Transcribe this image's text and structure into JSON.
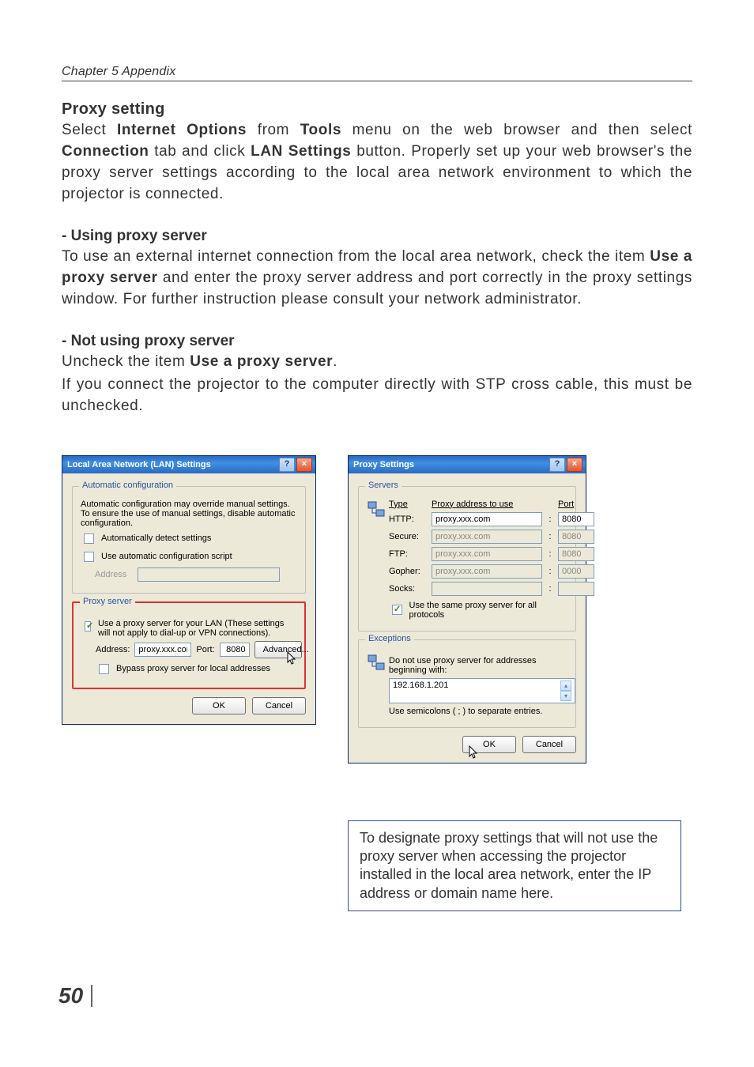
{
  "header": {
    "chapter": "Chapter 5 Appendix"
  },
  "section": {
    "title": "Proxy setting",
    "intro_parts": {
      "t1": "Select ",
      "b1": "Internet Options",
      "t2": " from ",
      "b2": "Tools",
      "t3": " menu on the web browser and then select ",
      "b3": "Connection",
      "t4": " tab and click ",
      "b4": "LAN Settings",
      "t5": " button. Properly set up your web browser's the proxy server settings according to the local area network environment to which the projector is connected."
    },
    "using_title": "- Using proxy server",
    "using_parts": {
      "t1": "To use an external internet connection from the local area network, check the item ",
      "b1": "Use a proxy server",
      "t2": " and enter the proxy server address and port correctly in the proxy settings window. For further instruction please consult your network administrator."
    },
    "notusing_title": "- Not using proxy server",
    "notusing_parts": {
      "t1": "Uncheck the item ",
      "b1": "Use a proxy server",
      "t2": "."
    },
    "notusing_text2": "If you connect the projector to the computer directly with STP cross cable, this must be unchecked."
  },
  "lan_dialog": {
    "title": "Local Area Network (LAN) Settings",
    "group_auto": "Automatic configuration",
    "auto_text": "Automatic configuration may override manual settings. To ensure the use of manual settings, disable automatic configuration.",
    "chk_detect": "Automatically detect settings",
    "chk_script": "Use automatic configuration script",
    "addr_label": "Address",
    "group_proxy": "Proxy server",
    "chk_useproxy": "Use a proxy server for your LAN (These settings will not apply to dial-up or VPN connections).",
    "addr2_label": "Address:",
    "addr2_value": "proxy.xxx.com",
    "port_label": "Port:",
    "port_value": "8080",
    "advanced": "Advanced...",
    "chk_bypass": "Bypass proxy server for local addresses",
    "ok": "OK",
    "cancel": "Cancel"
  },
  "proxy_dialog": {
    "title": "Proxy Settings",
    "group_servers": "Servers",
    "head_type": "Type",
    "head_addr": "Proxy address to use",
    "head_port": "Port",
    "rows": {
      "http": "HTTP:",
      "secure": "Secure:",
      "ftp": "FTP:",
      "gopher": "Gopher:",
      "socks": "Socks:"
    },
    "values": {
      "addr_main": "proxy.xxx.com",
      "port_main": "8080",
      "port_gopher": "0000"
    },
    "chk_same": "Use the same proxy server for all protocols",
    "group_exc": "Exceptions",
    "exc_text": "Do not use proxy server for addresses beginning with:",
    "exc_value": "192.168.1.201",
    "exc_note": "Use semicolons ( ; ) to separate entries.",
    "ok": "OK",
    "cancel": "Cancel"
  },
  "caption": "To designate proxy settings that will not use the proxy server when accessing the projector installed in the local area network, enter the IP address or domain name here.",
  "page_number": "50"
}
